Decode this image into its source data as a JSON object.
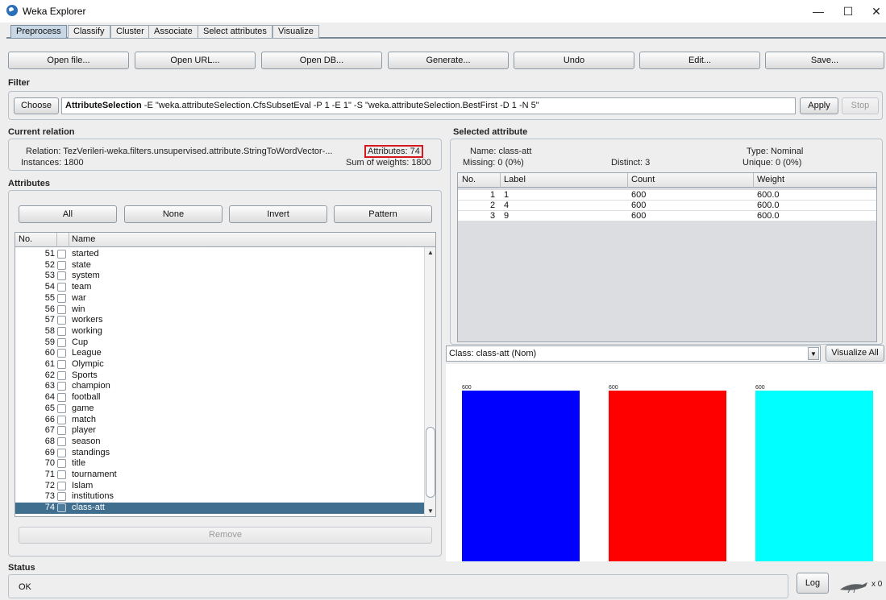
{
  "window": {
    "title": "Weka Explorer",
    "minimize": "—",
    "maximize": "☐",
    "close": "✕"
  },
  "tabs": [
    "Preprocess",
    "Classify",
    "Cluster",
    "Associate",
    "Select attributes",
    "Visualize"
  ],
  "toolbar": [
    "Open file...",
    "Open URL...",
    "Open DB...",
    "Generate...",
    "Undo",
    "Edit...",
    "Save..."
  ],
  "filter": {
    "title": "Filter",
    "choose_label": "Choose",
    "name": "AttributeSelection",
    "args": " -E \"weka.attributeSelection.CfsSubsetEval -P 1 -E 1\" -S \"weka.attributeSelection.BestFirst -D 1 -N 5\"",
    "apply_label": "Apply",
    "stop_label": "Stop"
  },
  "current_relation": {
    "title": "Current relation",
    "relation": "Relation: TezVerileri-weka.filters.unsupervised.attribute.StringToWordVector-...",
    "attributes": "Attributes: 74",
    "instances": "Instances: 1800",
    "sum_weights": "Sum of weights: 1800"
  },
  "attributes": {
    "title": "Attributes",
    "buttons": [
      "All",
      "None",
      "Invert",
      "Pattern"
    ],
    "col_no": "No.",
    "col_name": "Name",
    "rows": [
      {
        "no": "51",
        "name": "started"
      },
      {
        "no": "52",
        "name": "state"
      },
      {
        "no": "53",
        "name": "system"
      },
      {
        "no": "54",
        "name": "team"
      },
      {
        "no": "55",
        "name": "war"
      },
      {
        "no": "56",
        "name": "win"
      },
      {
        "no": "57",
        "name": "workers"
      },
      {
        "no": "58",
        "name": "working"
      },
      {
        "no": "59",
        "name": "Cup"
      },
      {
        "no": "60",
        "name": "League"
      },
      {
        "no": "61",
        "name": "Olympic"
      },
      {
        "no": "62",
        "name": "Sports"
      },
      {
        "no": "63",
        "name": "champion"
      },
      {
        "no": "64",
        "name": "football"
      },
      {
        "no": "65",
        "name": "game"
      },
      {
        "no": "66",
        "name": "match"
      },
      {
        "no": "67",
        "name": "player"
      },
      {
        "no": "68",
        "name": "season"
      },
      {
        "no": "69",
        "name": "standings"
      },
      {
        "no": "70",
        "name": "title"
      },
      {
        "no": "71",
        "name": "tournament"
      },
      {
        "no": "72",
        "name": "Islam"
      },
      {
        "no": "73",
        "name": "institutions"
      },
      {
        "no": "74",
        "name": "class-att"
      }
    ],
    "selected_no": "74",
    "remove_label": "Remove"
  },
  "selected_attribute": {
    "title": "Selected attribute",
    "name": "Name: class-att",
    "type": "Type: Nominal",
    "missing": "Missing: 0 (0%)",
    "distinct": "Distinct: 3",
    "unique": "Unique: 0 (0%)",
    "columns": [
      "No.",
      "Label",
      "Count",
      "Weight"
    ],
    "rows": [
      {
        "no": "1",
        "label": "1",
        "count": "600",
        "weight": "600.0"
      },
      {
        "no": "2",
        "label": "4",
        "count": "600",
        "weight": "600.0"
      },
      {
        "no": "3",
        "label": "9",
        "count": "600",
        "weight": "600.0"
      }
    ]
  },
  "class_selector": {
    "value": "Class: class-att (Nom)",
    "visualize_all": "Visualize All"
  },
  "histogram": {
    "bars": [
      {
        "label": "600",
        "color": "#0000ff"
      },
      {
        "label": "600",
        "color": "#ff0000"
      },
      {
        "label": "600",
        "color": "#00ffff"
      }
    ]
  },
  "status": {
    "title": "Status",
    "text": "OK",
    "log_label": "Log",
    "count": "x 0"
  }
}
